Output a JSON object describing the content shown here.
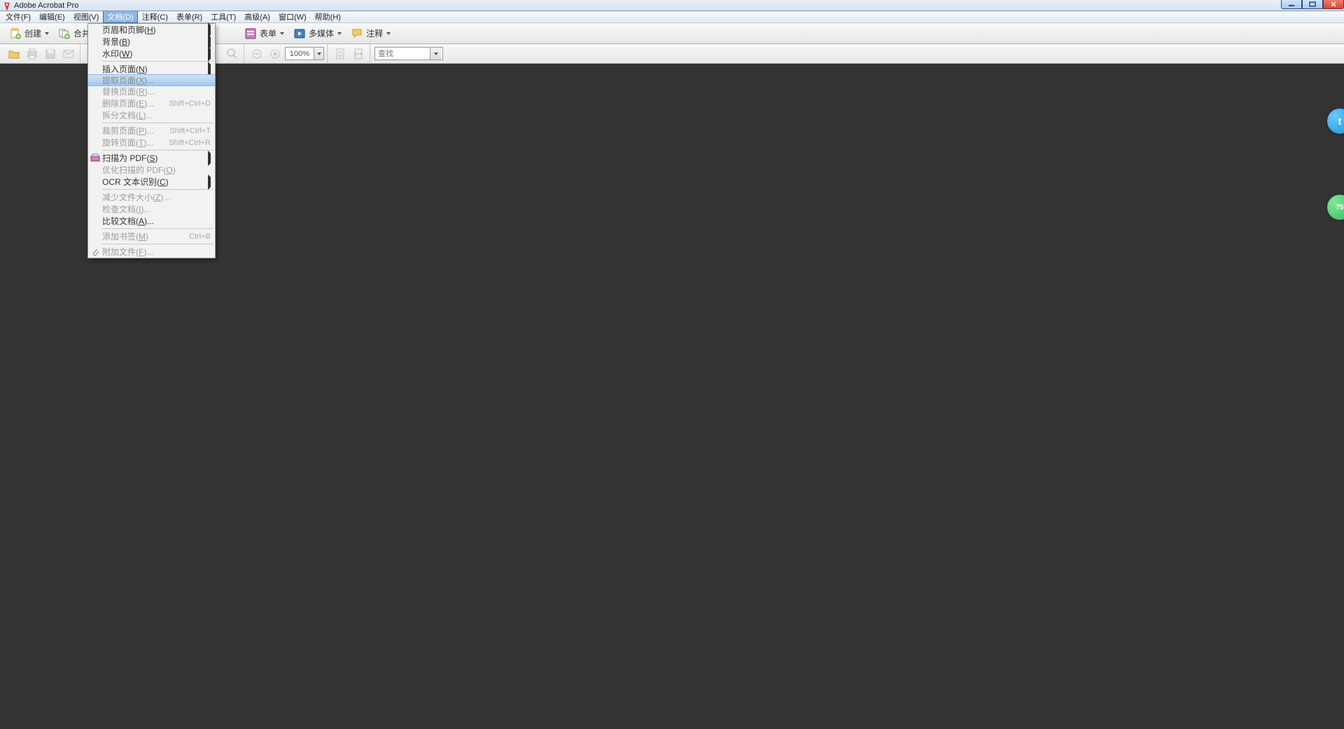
{
  "titlebar": {
    "title": "Adobe Acrobat Pro"
  },
  "menubar": {
    "items": [
      {
        "label": "文件(F)"
      },
      {
        "label": "编辑(E)"
      },
      {
        "label": "视图(V)"
      },
      {
        "label": "文档(D)",
        "active": true
      },
      {
        "label": "注释(C)"
      },
      {
        "label": "表单(R)"
      },
      {
        "label": "工具(T)"
      },
      {
        "label": "高级(A)"
      },
      {
        "label": "窗口(W)"
      },
      {
        "label": "帮助(H)"
      }
    ]
  },
  "toolbar1": {
    "create": "创建",
    "combine": "合并",
    "forms": "表单",
    "multimedia": "多媒体",
    "comment": "注释"
  },
  "toolbar2": {
    "zoom": "100%",
    "find_placeholder": "查找"
  },
  "dropdown": {
    "items": [
      {
        "type": "item",
        "label": "页眉和页脚(H)",
        "hotchar": "H",
        "arrow": true
      },
      {
        "type": "item",
        "label": "背景(B)",
        "hotchar": "B",
        "arrow": true
      },
      {
        "type": "item",
        "label": "水印(W)",
        "hotchar": "W",
        "arrow": true
      },
      {
        "type": "sep"
      },
      {
        "type": "item",
        "label": "插入页面(N)",
        "hotchar": "N",
        "arrow": true
      },
      {
        "type": "item",
        "label": "提取页面(X)...",
        "hotchar": "X",
        "disabled": true,
        "hover": true
      },
      {
        "type": "item",
        "label": "替换页面(R)...",
        "hotchar": "R",
        "disabled": true
      },
      {
        "type": "item",
        "label": "删除页面(E)...",
        "hotchar": "E",
        "shortcut": "Shift+Ctrl+D",
        "disabled": true
      },
      {
        "type": "item",
        "label": "拆分文档(L)...",
        "hotchar": "L",
        "disabled": true
      },
      {
        "type": "sep"
      },
      {
        "type": "item",
        "label": "裁剪页面(P)...",
        "hotchar": "P",
        "shortcut": "Shift+Ctrl+T",
        "disabled": true
      },
      {
        "type": "item",
        "label": "旋转页面(T)...",
        "hotchar": "T",
        "shortcut": "Shift+Ctrl+R",
        "disabled": true
      },
      {
        "type": "sep"
      },
      {
        "type": "item",
        "label": "扫描为 PDF(S)",
        "hotchar": "S",
        "arrow": true,
        "icon": "scanner"
      },
      {
        "type": "item",
        "label": "优化扫描的 PDF(O)",
        "hotchar": "O",
        "disabled": true
      },
      {
        "type": "item",
        "label": "OCR 文本识别(C)",
        "hotchar": "C",
        "arrow": true
      },
      {
        "type": "sep"
      },
      {
        "type": "item",
        "label": "减少文件大小(Z)...",
        "hotchar": "Z",
        "disabled": true
      },
      {
        "type": "item",
        "label": "检查文档(I)...",
        "hotchar": "I",
        "disabled": true
      },
      {
        "type": "item",
        "label": "比较文档(A)...",
        "hotchar": "A"
      },
      {
        "type": "sep"
      },
      {
        "type": "item",
        "label": "添加书签(M)",
        "hotchar": "M",
        "shortcut": "Ctrl+B",
        "disabled": true
      },
      {
        "type": "sep"
      },
      {
        "type": "item",
        "label": "附加文件(F)...",
        "hotchar": "F",
        "disabled": true,
        "icon": "attach"
      }
    ]
  },
  "badges": {
    "green_text": "75"
  }
}
